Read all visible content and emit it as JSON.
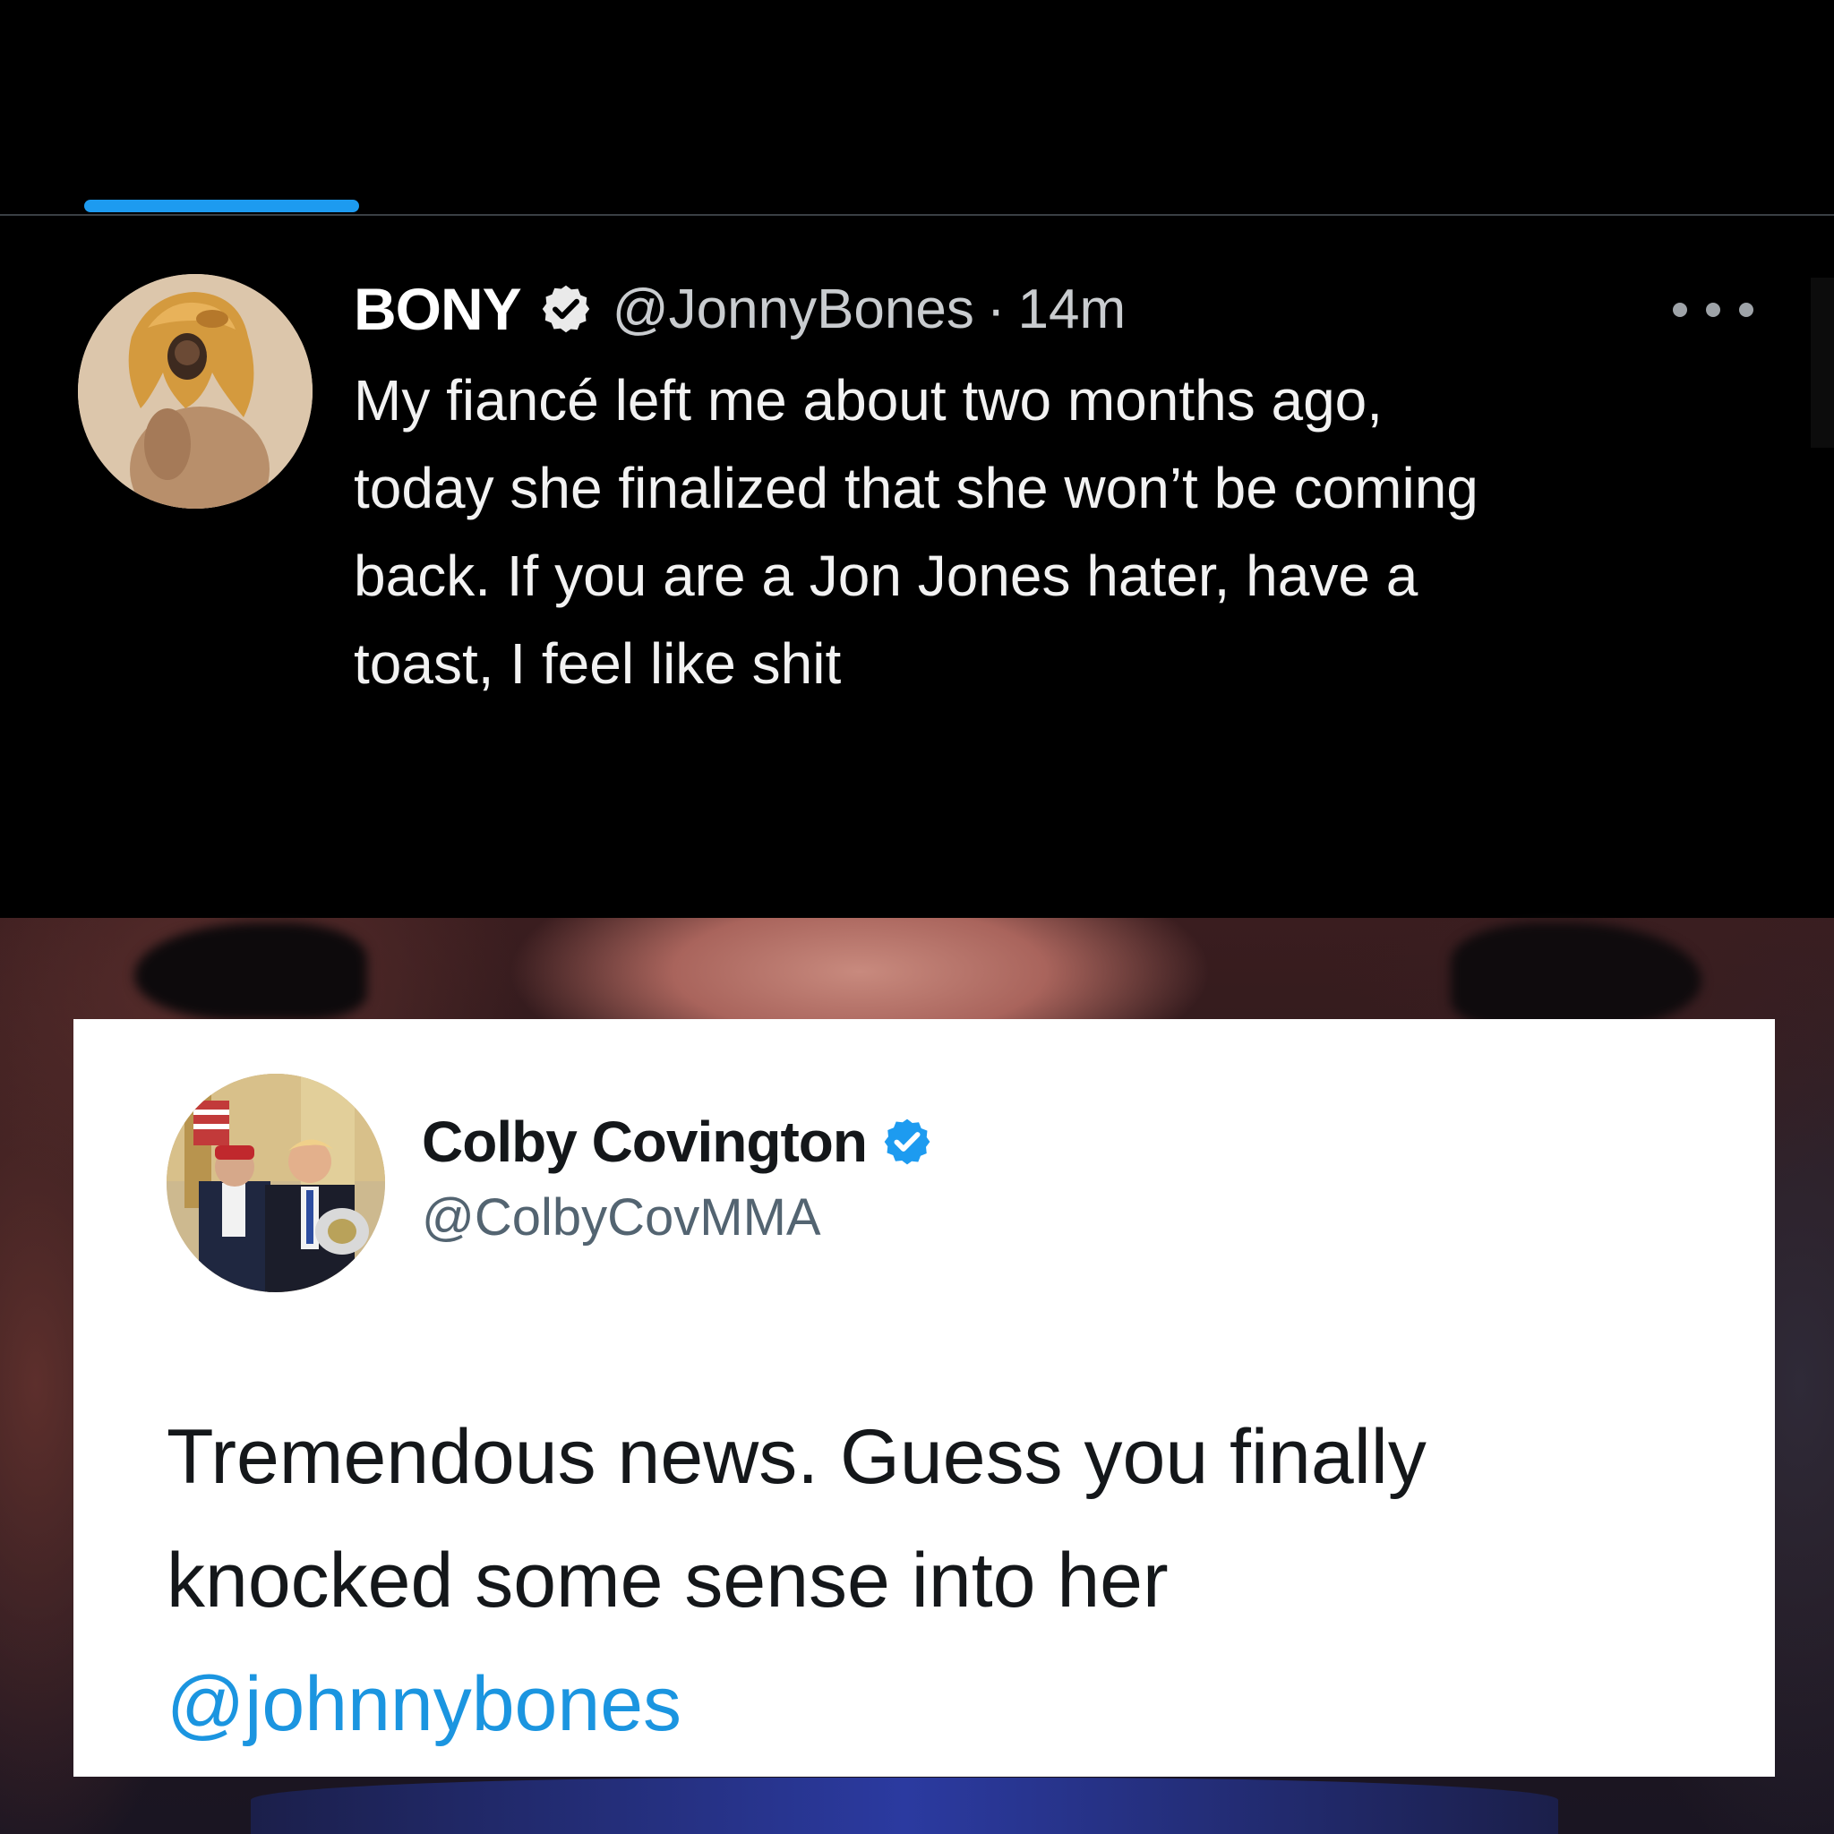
{
  "colors": {
    "accent_blue": "#1d9bf0",
    "mention_blue": "#1b95e0",
    "dark_background": "#000000",
    "card_background": "#ffffff"
  },
  "top_tweet": {
    "avatar": "lion-headdress-avatar",
    "display_name": "BONY",
    "verified_icon": "verified-badge-icon",
    "handle": "@JonnyBones",
    "separator": "·",
    "time": "14m",
    "more_icon": "more-options-icon",
    "text": "My fiancé left me about two months ago,\ntoday she finalized that she won’t be coming\nback. If you are a Jon Jones hater, have a\ntoast, I feel like shit"
  },
  "quoted_tweet": {
    "avatar": "two-men-photo-avatar",
    "display_name": "Colby Covington",
    "verified_icon": "verified-badge-icon",
    "handle": "@ColbyCovMMA",
    "text_lines": [
      "Tremendous news. Guess you finally",
      "knocked some sense into her"
    ],
    "mention": "@johnnybones"
  }
}
